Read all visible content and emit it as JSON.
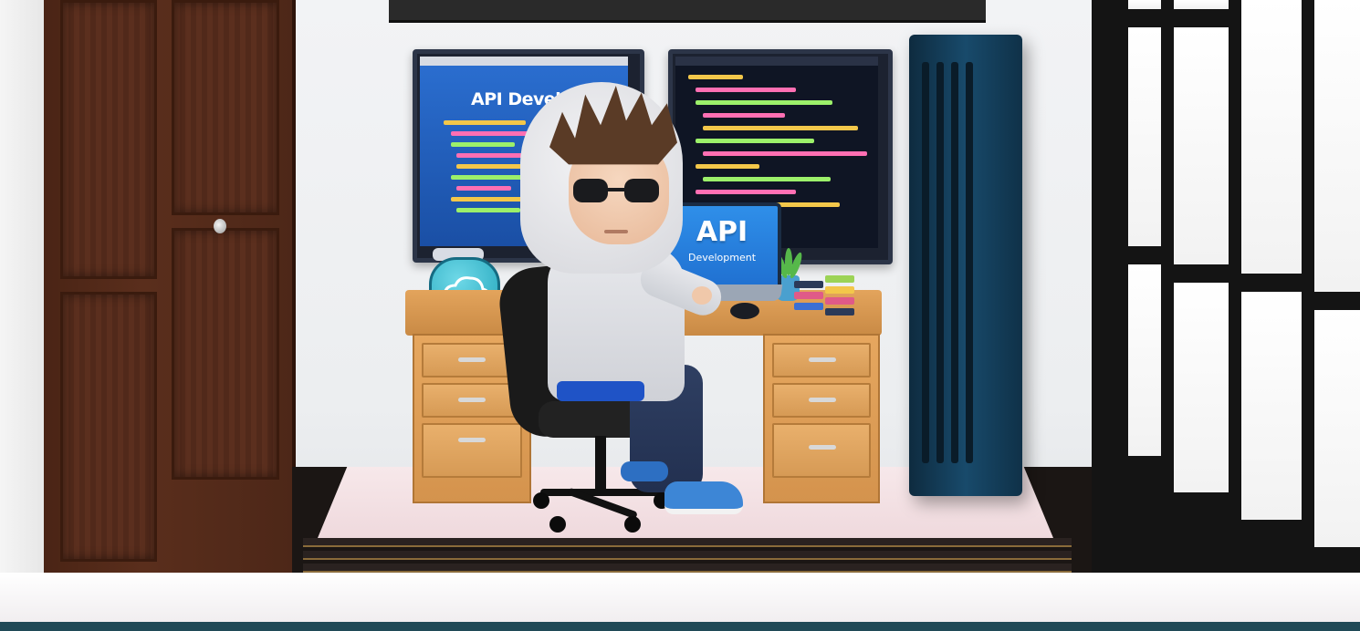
{
  "scene": {
    "left_monitor": {
      "title": "API Developm"
    },
    "laptop": {
      "title": "API",
      "subtitle": "Development"
    }
  },
  "colors": {
    "hoodie": "#e7e8ec",
    "screen_blue": "#2b6fd1",
    "desk_wood": "#e3a45c",
    "wardrobe_wood": "#5a2e1c",
    "tower": "#184a6b",
    "accent_stripe": "#204a57"
  }
}
